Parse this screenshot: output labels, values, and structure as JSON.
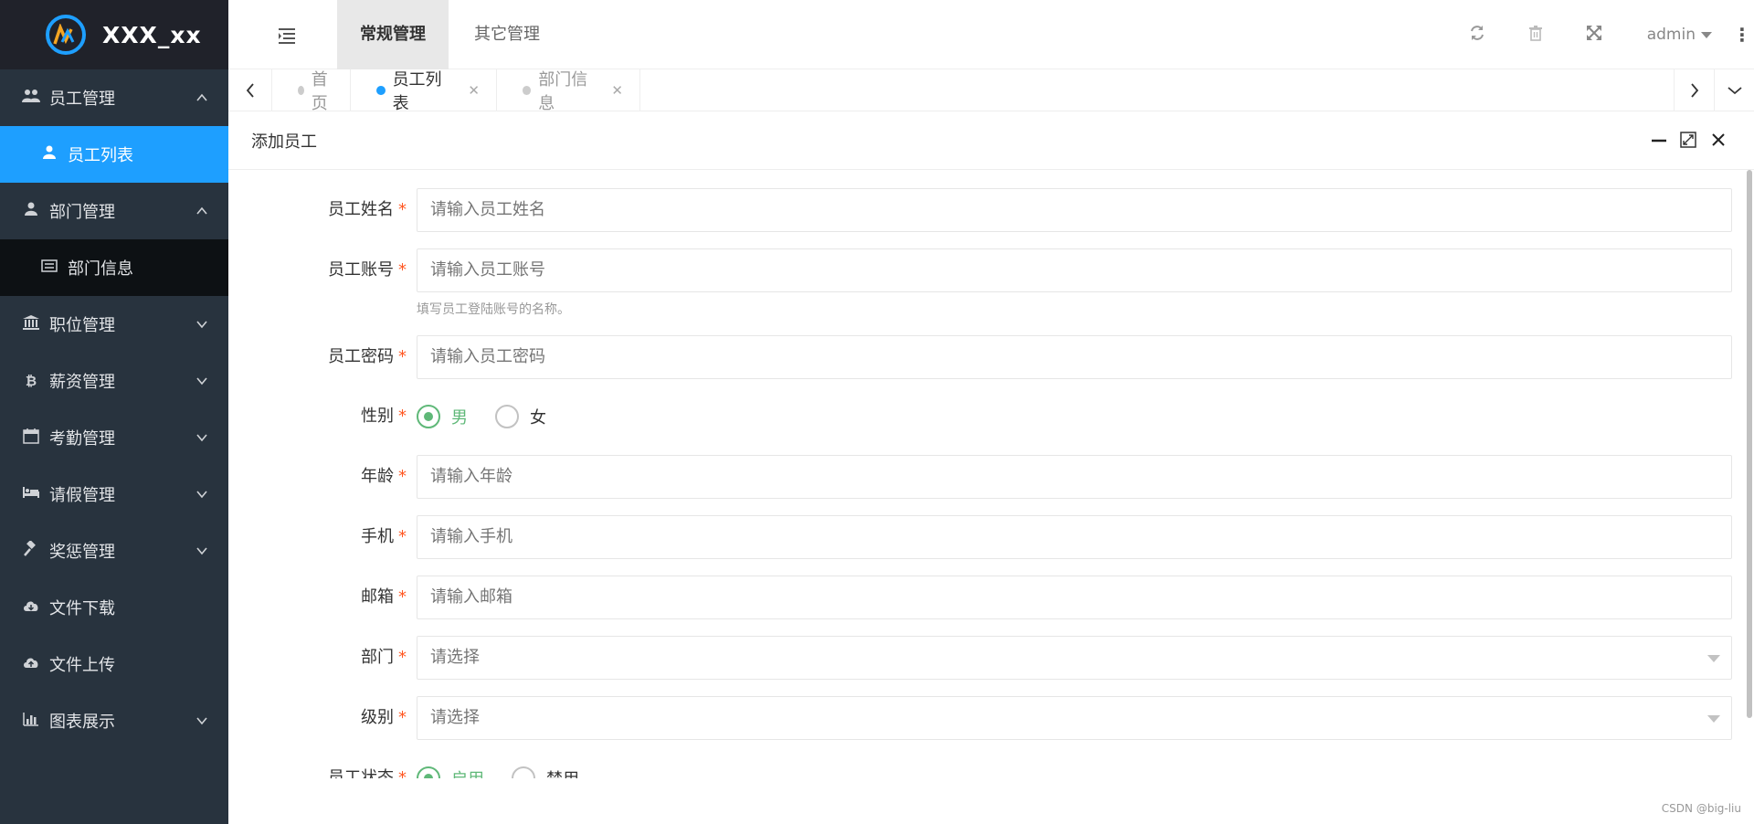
{
  "app": {
    "title": "XXX_xx"
  },
  "sidebar": {
    "items": [
      {
        "label": "员工管理",
        "icon": "users-icon",
        "expanded": true,
        "children": [
          {
            "label": "员工列表",
            "icon": "user-icon",
            "active": true
          }
        ]
      },
      {
        "label": "部门管理",
        "icon": "user-icon",
        "expanded": true,
        "children": [
          {
            "label": "部门信息",
            "icon": "list-icon"
          }
        ]
      },
      {
        "label": "职位管理",
        "icon": "bank-icon"
      },
      {
        "label": "薪资管理",
        "icon": "bitcoin-icon"
      },
      {
        "label": "考勤管理",
        "icon": "calendar-icon"
      },
      {
        "label": "请假管理",
        "icon": "bed-icon"
      },
      {
        "label": "奖惩管理",
        "icon": "gavel-icon"
      },
      {
        "label": "文件下载",
        "icon": "cloud-download-icon"
      },
      {
        "label": "文件上传",
        "icon": "cloud-upload-icon"
      },
      {
        "label": "图表展示",
        "icon": "bar-chart-icon"
      }
    ]
  },
  "header": {
    "tabs": [
      {
        "label": "常规管理",
        "active": true
      },
      {
        "label": "其它管理"
      }
    ],
    "user": "admin"
  },
  "tabs": [
    {
      "label": "首页"
    },
    {
      "label": "员工列表",
      "active": true
    },
    {
      "label": "部门信息"
    }
  ],
  "dialog": {
    "title": "添加员工",
    "fields": {
      "name": {
        "label": "员工姓名",
        "placeholder": "请输入员工姓名"
      },
      "account": {
        "label": "员工账号",
        "placeholder": "请输入员工账号",
        "hint": "填写员工登陆账号的名称。"
      },
      "password": {
        "label": "员工密码",
        "placeholder": "请输入员工密码"
      },
      "gender": {
        "label": "性别",
        "options": [
          "男",
          "女"
        ],
        "selected": "男"
      },
      "age": {
        "label": "年龄",
        "placeholder": "请输入年龄"
      },
      "phone": {
        "label": "手机",
        "placeholder": "请输入手机"
      },
      "email": {
        "label": "邮箱",
        "placeholder": "请输入邮箱"
      },
      "dept": {
        "label": "部门",
        "placeholder": "请选择"
      },
      "level": {
        "label": "级别",
        "placeholder": "请选择"
      },
      "status": {
        "label": "员工状态",
        "options": [
          "启用",
          "禁用"
        ],
        "selected": "启用"
      }
    },
    "required_mark": "*"
  },
  "watermark": "CSDN @big-liu",
  "colors": {
    "accent": "#1e9fff",
    "sidebar_bg": "#28333e",
    "radio_on": "#5fb878",
    "required": "#ff5722"
  }
}
